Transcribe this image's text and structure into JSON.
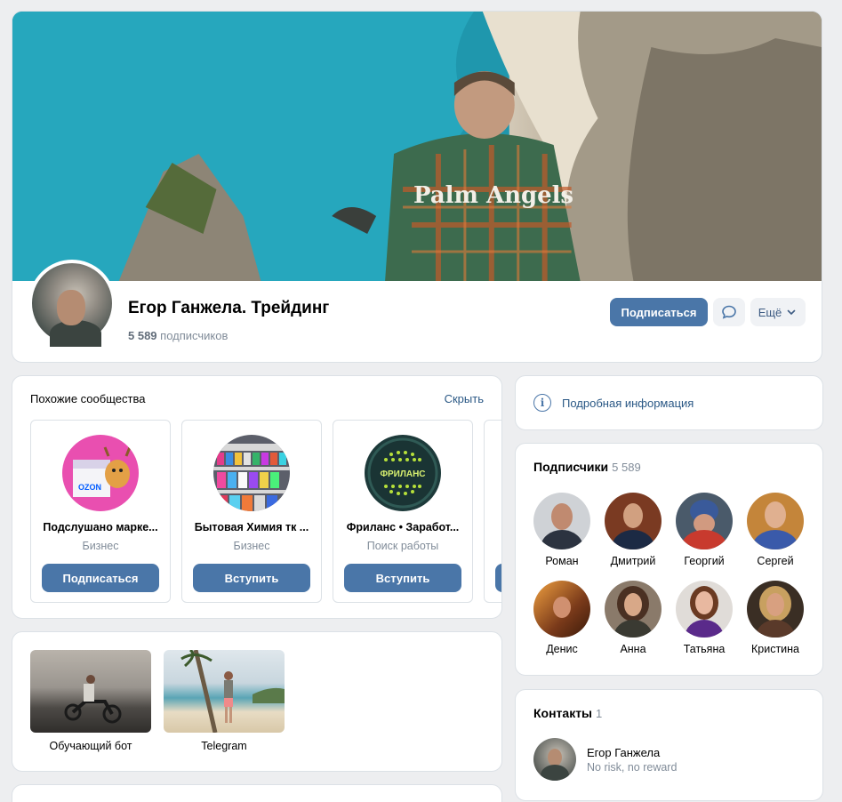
{
  "group": {
    "title": "Егор Ганжела. Трейдинг",
    "subscribers_count": "5 589",
    "subscribers_label": "подписчиков"
  },
  "actions": {
    "subscribe": "Подписаться",
    "more": "Ещё"
  },
  "cover": {
    "shirt_text": "Palm Angels"
  },
  "similar": {
    "title": "Похожие сообщества",
    "hide": "Скрыть",
    "items": [
      {
        "name": "Подслушано марке...",
        "category": "Бизнес",
        "button": "Подписаться",
        "logo_text": "OZON"
      },
      {
        "name": "Бытовая Химия тк ...",
        "category": "Бизнес",
        "button": "Вступить"
      },
      {
        "name": "Фриланс • Заработ...",
        "category": "Поиск работы",
        "button": "Вступить",
        "logo_text": "ФРИЛАНС"
      }
    ]
  },
  "links": [
    {
      "caption": "Обучающий бот"
    },
    {
      "caption": "Telegram"
    }
  ],
  "info": {
    "label": "Подробная информация"
  },
  "followers": {
    "title": "Подписчики",
    "count": "5 589",
    "people": [
      {
        "name": "Роман",
        "color": "#c9ccd0"
      },
      {
        "name": "Дмитрий",
        "color": "#8a4a2e"
      },
      {
        "name": "Георгий",
        "color": "#b33c2e"
      },
      {
        "name": "Сергей",
        "color": "#c4853a"
      },
      {
        "name": "Денис",
        "color": "#a35a1e"
      },
      {
        "name": "Анна",
        "color": "#6b5a4a"
      },
      {
        "name": "Татьяна",
        "color": "#d9d4cf"
      },
      {
        "name": "Кристина",
        "color": "#5a4a3a"
      }
    ]
  },
  "contacts": {
    "title": "Контакты",
    "count": "1",
    "items": [
      {
        "name": "Егор Ганжела",
        "desc": "No risk, no reward"
      }
    ]
  },
  "colors": {
    "accent": "#4a76a8",
    "link": "#2a5885",
    "background": "#edeef0"
  }
}
